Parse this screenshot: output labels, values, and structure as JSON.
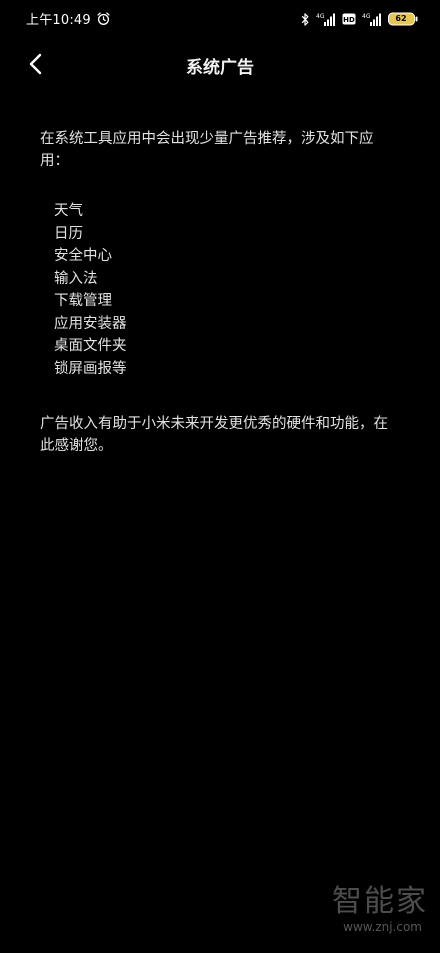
{
  "status_bar": {
    "time": "上午10:49",
    "network_1": "4G",
    "network_2": "4G",
    "hd_label": "HD",
    "battery_level": "62",
    "icons": [
      "alarm-icon",
      "bluetooth-icon",
      "signal-icon",
      "hd-icon",
      "signal-icon",
      "battery-icon"
    ]
  },
  "nav": {
    "back_icon": "chevron-left-icon",
    "title": "系统广告"
  },
  "content": {
    "intro": "在系统工具应用中会出现少量广告推荐，涉及如下应用：",
    "apps": [
      "天气",
      "日历",
      "安全中心",
      "输入法",
      "下载管理",
      "应用安装器",
      "桌面文件夹",
      "锁屏画报等"
    ],
    "outro": "广告收入有助于小米未来开发更优秀的硬件和功能，在此感谢您。"
  },
  "watermark": {
    "logo": "智能家",
    "url": "www.znj.com"
  },
  "colors": {
    "background": "#000000",
    "text": "#e2e2e2",
    "battery": "#e8c84a"
  }
}
